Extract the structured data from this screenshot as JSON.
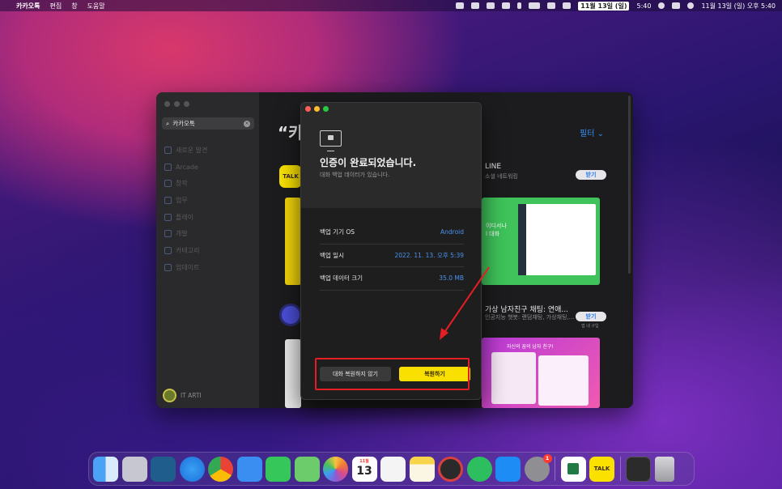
{
  "menubar": {
    "apple": "",
    "app_name": "카카오톡",
    "menus": [
      "편집",
      "창",
      "도움말"
    ],
    "date_badge": "11월 13일 (일)",
    "badge_time": "5:40",
    "datetime": "11월 13일 (일) 오후 5:40"
  },
  "sidebar": {
    "search_value": "카카오톡",
    "items": [
      {
        "label": "새로운 발견",
        "icon": "star-icon"
      },
      {
        "label": "Arcade",
        "icon": "joystick-icon"
      },
      {
        "label": "창작",
        "icon": "brush-icon"
      },
      {
        "label": "업무",
        "icon": "paperplane-icon"
      },
      {
        "label": "플레이",
        "icon": "rocket-icon"
      },
      {
        "label": "개발",
        "icon": "hammer-icon"
      },
      {
        "label": "카테고리",
        "icon": "grid-icon"
      },
      {
        "label": "업데이트",
        "icon": "download-icon"
      }
    ],
    "user_name": "IT ARTI"
  },
  "store": {
    "heading": "“카",
    "filter": "필터",
    "filter_icon": "chevron-down-icon",
    "kakao_icon_text": "TALK",
    "line_name": "LINE",
    "line_category": "소셜 네트워킹",
    "get_label": "받기",
    "line_promo_line1": "이디서나",
    "line_promo_line2": "l 대화",
    "app2_name": "가상 남자친구 채팅: 연애...",
    "app2_sub": "인공지능 챗봇: 랜덤채팅, 가상채팅,...",
    "app2_get": "받기",
    "app2_note": "앱 내 구입",
    "pink_title": "자신의 꿈의 남자 친구!"
  },
  "modal": {
    "title": "인증이 완료되었습니다.",
    "subtitle": "대화 백업 데이터가 있습니다.",
    "rows": [
      {
        "key": "백업 기기 OS",
        "value": "Android"
      },
      {
        "key": "백업 일시",
        "value": "2022. 11. 13. 오후 5:39"
      },
      {
        "key": "백업 데이터 크기",
        "value": "35.0 MB"
      }
    ],
    "btn_skip": "대화 복원하지 않기",
    "btn_restore": "복원하기"
  },
  "colors": {
    "accent_blue": "#4a93f0",
    "kakao_yellow": "#f9e000",
    "highlight_red": "#e51e25"
  },
  "dock": {
    "calendar_month": "11월",
    "calendar_day": "13",
    "settings_badge": "1",
    "kakao_label": "TALK",
    "apps": [
      "Finder",
      "Launchpad",
      "Paw",
      "Safari",
      "Chrome",
      "Mail",
      "Messages",
      "Maps",
      "Photos",
      "Calendar",
      "Reminders",
      "Notes",
      "Photo Booth",
      "Evernote",
      "App Store",
      "System Preferences",
      "Excel",
      "KakaoTalk",
      "Terminal",
      "Trash"
    ]
  }
}
